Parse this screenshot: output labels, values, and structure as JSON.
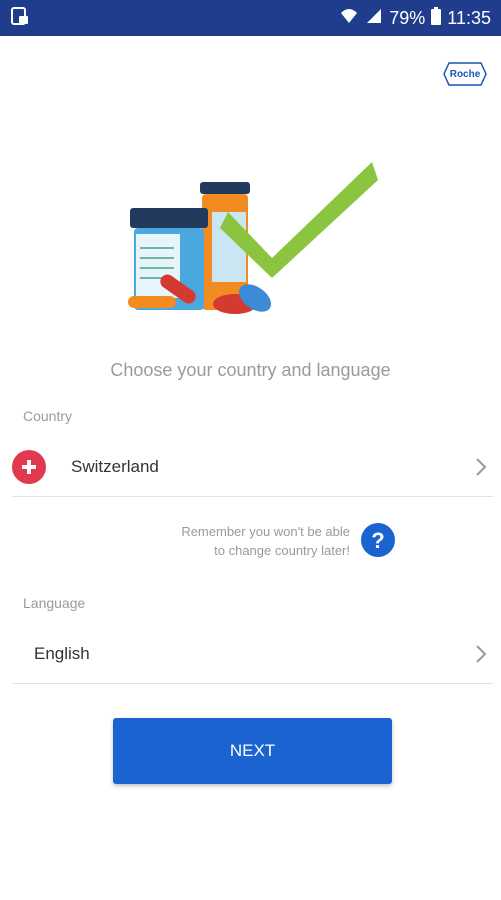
{
  "status_bar": {
    "battery": "79%",
    "time": "11:35",
    "icons": [
      "notification-icon",
      "wifi-icon",
      "signal-icon",
      "battery-icon"
    ]
  },
  "brand": {
    "logo_text": "Roche",
    "color": "#1a55b5"
  },
  "prompt": "Choose your country and language",
  "country": {
    "label": "Country",
    "value": "Switzerland",
    "flag_icon": "swiss-flag-icon"
  },
  "hint": {
    "line1": "Remember you won't be able",
    "line2": "to change country later!"
  },
  "language": {
    "label": "Language",
    "value": "English"
  },
  "next_button": {
    "label": "NEXT",
    "color": "#1a63d0"
  },
  "colors": {
    "status_bar": "#1f3d8c",
    "accent": "#1a63d0",
    "flag_red": "#e3394f",
    "check_green": "#8bc53f"
  }
}
